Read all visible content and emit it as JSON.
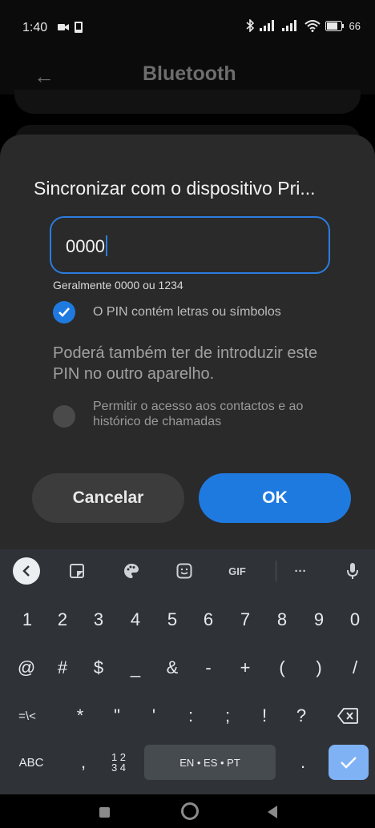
{
  "status_bar": {
    "time": "1:40",
    "battery": "66"
  },
  "app": {
    "title": "Bluetooth"
  },
  "dialog": {
    "title": "Sincronizar com o dispositivo Pri...",
    "pin_value": "0000",
    "hint": "Geralmente 0000 ou 1234",
    "pin_option_label": "O PIN contém letras ou símbolos",
    "info": "Poderá também ter de introduzir este PIN no outro aparelho.",
    "access_label": "Permitir o acesso aos contactos e ao histórico de chamadas",
    "cancel_label": "Cancelar",
    "ok_label": "OK"
  },
  "keyboard": {
    "toolbar": {
      "gif_label": "GIF",
      "more_label": "···"
    },
    "row1": [
      "1",
      "2",
      "3",
      "4",
      "5",
      "6",
      "7",
      "8",
      "9",
      "0"
    ],
    "row2": [
      "@",
      "#",
      "$",
      "_",
      "&",
      "-",
      "+",
      "(",
      ")",
      "/"
    ],
    "row3": {
      "symbols_toggle": "=\\<",
      "keys": [
        "*",
        "\"",
        "'",
        ":",
        ";",
        "!",
        "?"
      ]
    },
    "row4": {
      "abc_label": "ABC",
      "comma": ",",
      "numpad_top": "1 2",
      "numpad_bottom": "3 4",
      "space_label": "EN • ES • PT",
      "period": "."
    }
  },
  "colors": {
    "accent": "#1f7ae0",
    "dialog_bg": "#2a2a2a",
    "keyboard_bg": "#2f3337"
  }
}
